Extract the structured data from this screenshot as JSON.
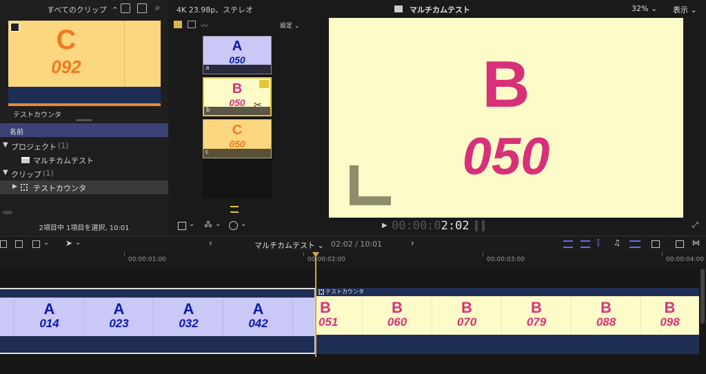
{
  "browser": {
    "header_label": "すべてのクリップ",
    "selected_clip_letter": "C",
    "selected_clip_number": "092",
    "selected_clip_name": "テストカウンタ",
    "column_name": "名前",
    "project_group": "プロジェクト",
    "project_count": "(1)",
    "project_item": "マルチカムテスト",
    "clip_group": "クリップ",
    "clip_count": "(1)",
    "clip_item": "テストカウンタ",
    "status": "2項目中 1項目を選択, 10:01"
  },
  "angle_viewer": {
    "settings_label": "設定",
    "angles": [
      {
        "letter": "A",
        "number": "050",
        "label": "a"
      },
      {
        "letter": "B",
        "number": "050",
        "label": "b"
      },
      {
        "letter": "C",
        "number": "050",
        "label": "c"
      }
    ]
  },
  "viewer": {
    "format_info": "4K 23.98p、ステレオ",
    "project_title": "マルチカムテスト",
    "zoom": "32%",
    "view_menu": "表示",
    "letter": "B",
    "number": "050",
    "timecode_dim": "00:00:0",
    "timecode_bright": "2:02"
  },
  "timeline": {
    "project_title": "マルチカムテスト",
    "position": "02:02 / 10:01",
    "ruler_labels": [
      "00:00:01:00",
      "00:00:02:00",
      "00:00:03:00",
      "00:00:04:00"
    ],
    "clip_label": "テストカウンタ",
    "left_cells": [
      {
        "letter": "A",
        "number": "014"
      },
      {
        "letter": "A",
        "number": "023"
      },
      {
        "letter": "A",
        "number": "032"
      },
      {
        "letter": "A",
        "number": "042"
      }
    ],
    "right_cells": [
      {
        "letter": "B",
        "number": "051"
      },
      {
        "letter": "B",
        "number": "060"
      },
      {
        "letter": "B",
        "number": "070"
      },
      {
        "letter": "B",
        "number": "079"
      },
      {
        "letter": "B",
        "number": "088"
      },
      {
        "letter": "B",
        "number": "098"
      }
    ]
  },
  "colors": {
    "blue_letter": "#0c1aa8",
    "pink_letter": "#d9307a",
    "orange_letter": "#f07a20",
    "lavender": "#c9c8f6",
    "cream": "#fdfcc8",
    "apricot": "#fdd780",
    "navy": "#1e2e54"
  }
}
